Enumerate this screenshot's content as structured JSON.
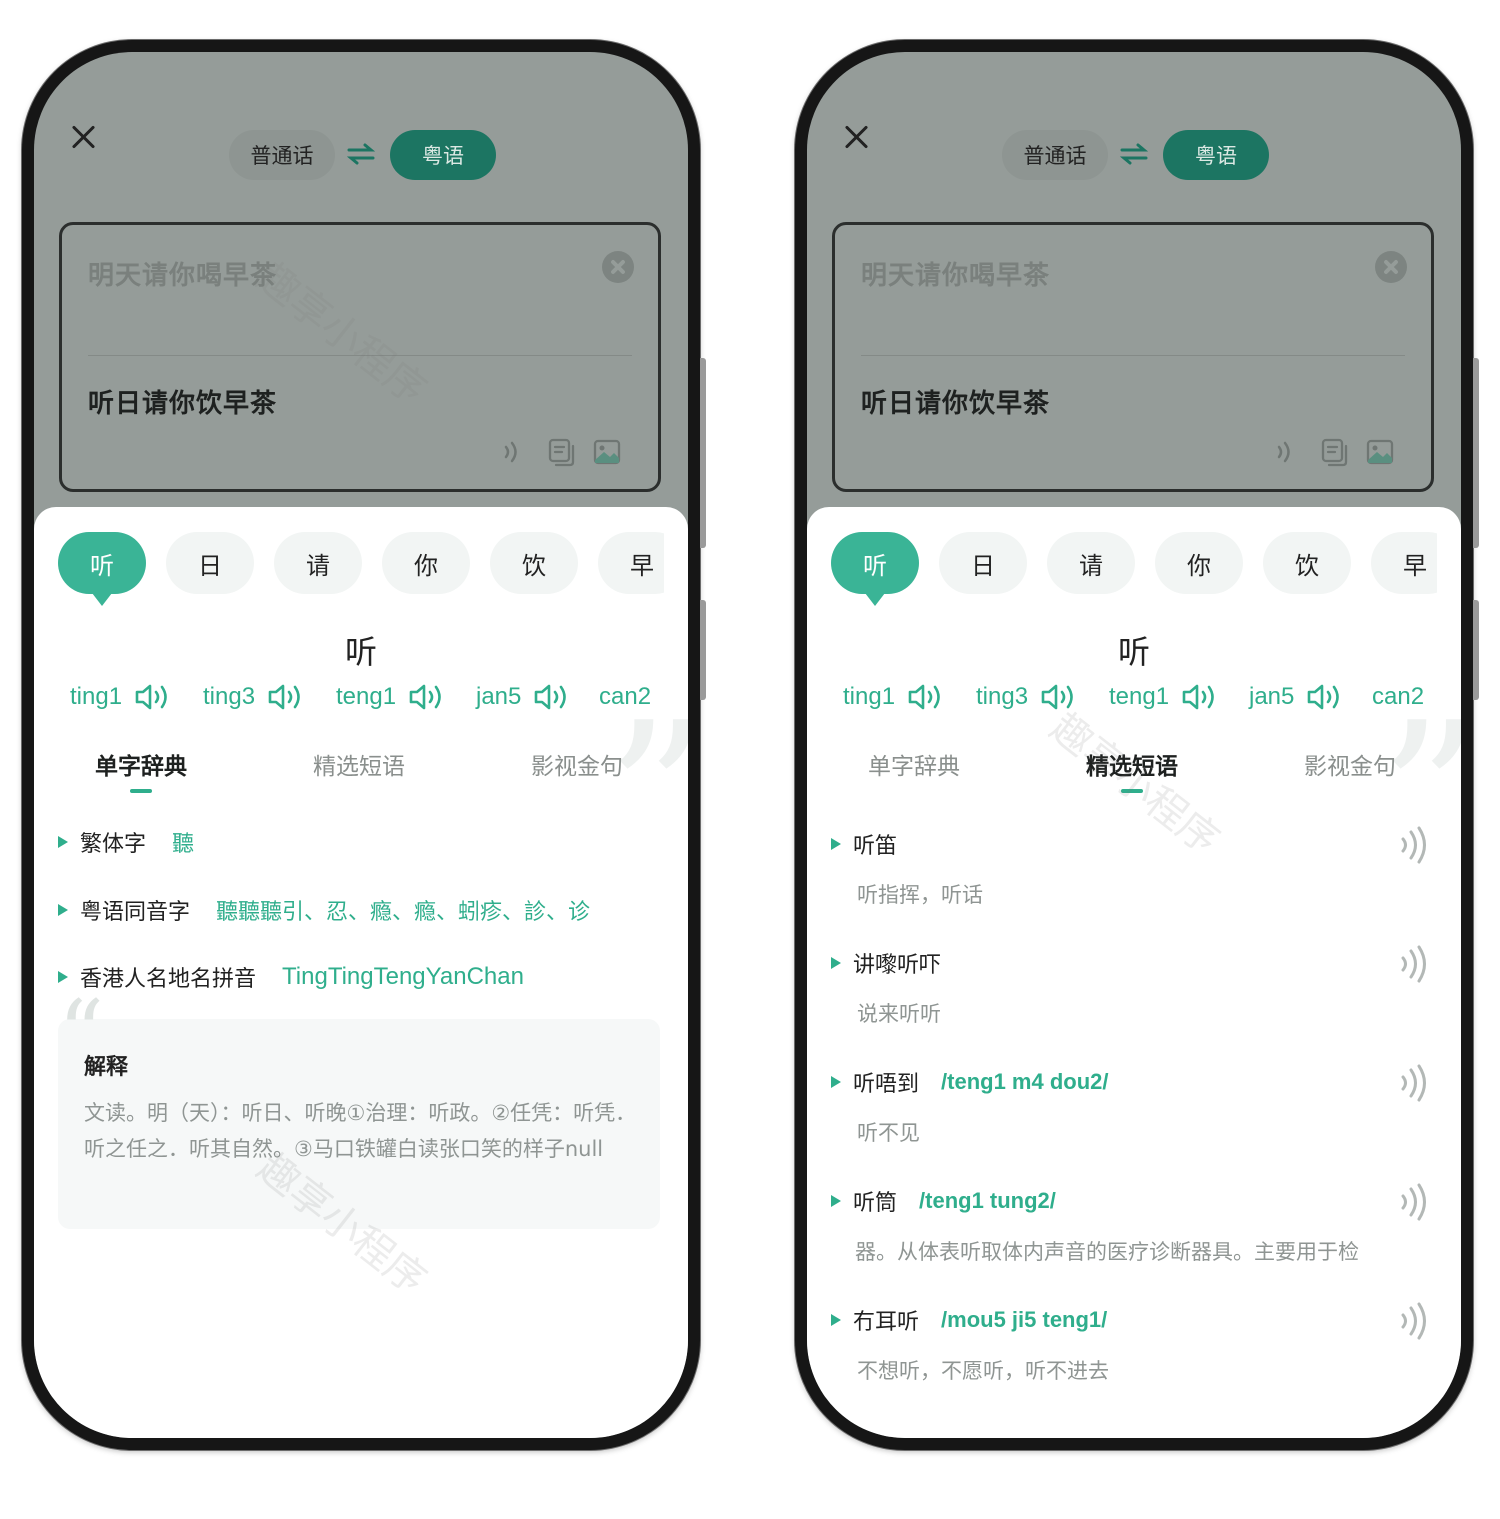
{
  "screens": [
    {
      "lang": {
        "source": "普通话",
        "target": "粤语"
      },
      "input_text": "明天请你喝早茶",
      "output_text": "听日请你饮早茶",
      "chars": [
        "听",
        "日",
        "请",
        "你",
        "饮",
        "早"
      ],
      "selected_char": "听",
      "prons": [
        "ting1",
        "ting3",
        "teng1",
        "jan5",
        "can2"
      ],
      "tabs": [
        "单字辞典",
        "精选短语",
        "影视金句"
      ],
      "active_tab": "单字辞典",
      "dictionary": {
        "traditional_label": "繁体字",
        "traditional_value": "聽",
        "homophone_label": "粤语同音字",
        "homophone_value": "聽聽聽引、忍、瘾、瘾、蚓疹、診、诊",
        "hk_label": "香港人名地名拼音",
        "hk_value": "TingTingTengYanChan"
      },
      "explain": {
        "title": "解释",
        "body": "文读。明（天）：听日、听晚①治理：听政。②任凭：听凭．听之任之．听其自然。③马口铁罐白读张口笑的样子null"
      },
      "watermark": "趣享小程序"
    },
    {
      "lang": {
        "source": "普通话",
        "target": "粤语"
      },
      "input_text": "明天请你喝早茶",
      "output_text": "听日请你饮早茶",
      "chars": [
        "听",
        "日",
        "请",
        "你",
        "饮",
        "早"
      ],
      "selected_char": "听",
      "prons": [
        "ting1",
        "ting3",
        "teng1",
        "jan5",
        "can2"
      ],
      "tabs": [
        "单字辞典",
        "精选短语",
        "影视金句"
      ],
      "active_tab": "精选短语",
      "phrases": [
        {
          "word": "听笛",
          "pinyin": "",
          "meaning": "听指挥，听话"
        },
        {
          "word": "讲嚟听吓",
          "pinyin": "",
          "meaning": "说来听听"
        },
        {
          "word": "听唔到",
          "pinyin": "/teng1 m4 dou2/",
          "meaning": "听不见"
        },
        {
          "word": "听筒",
          "pinyin": "/teng1 tung2/",
          "meaning": "器。从体表听取体内声音的医疗诊断器具。主要用于检"
        },
        {
          "word": "冇耳听",
          "pinyin": "/mou5 ji5 teng1/",
          "meaning": "不想听，不愿听，听不进去"
        }
      ],
      "watermark": "趣享小程序"
    }
  ],
  "colors": {
    "accent": "#2fae8c",
    "accent_dark": "#1c7562",
    "overlay": "#959c99"
  },
  "icons": [
    "close-icon",
    "swap-icon",
    "clear-icon",
    "sound-icon",
    "copy-icon",
    "image-icon",
    "speaker-icon"
  ]
}
